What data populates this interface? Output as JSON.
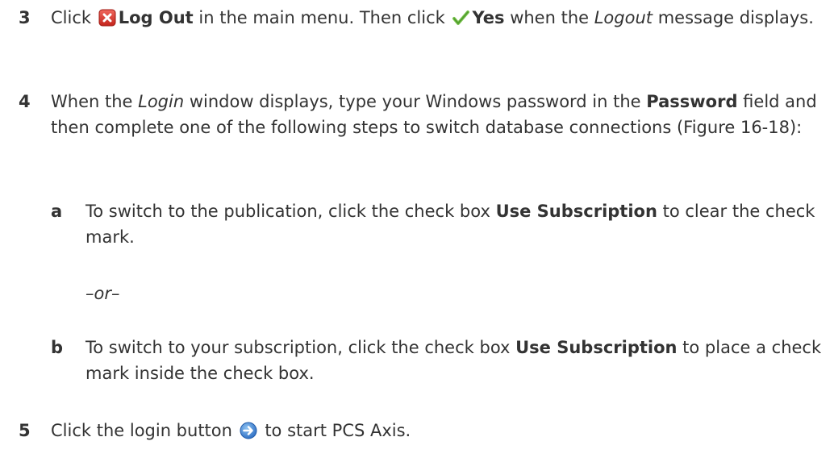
{
  "steps": [
    {
      "number": "3",
      "text_before_icon": "Click ",
      "icon": "logout-x-icon",
      "bold1": "Log Out",
      "text_mid": " in the main menu. Then click ",
      "icon2": "checkmark-icon",
      "bold2": "Yes",
      "text_mid2": " when the ",
      "italic1": "Logout",
      "text_end": " message displays."
    },
    {
      "number": "4",
      "text1": "When the ",
      "italic1": "Login",
      "text2": " window displays, type your Windows password in the ",
      "bold1": "Password",
      "text3": " field and then complete one of the following steps to switch database connections (Figure 16-18):",
      "sub_steps": [
        {
          "letter": "a",
          "text1": "To switch to the publication, click the check box ",
          "bold1": "Use Subscription",
          "text2": " to clear the check mark."
        },
        {
          "letter": "b",
          "text1": "To switch to your subscription, click the check box ",
          "bold1": "Use Subscription",
          "text2": " to place a check mark inside the check box."
        }
      ],
      "or_text": "–or–"
    },
    {
      "number": "5",
      "text1": "Click the login button ",
      "icon": "login-arrow-icon",
      "text2": " to start PCS Axis."
    }
  ],
  "colors": {
    "text": "#333333",
    "logout_icon": "#d9342b",
    "checkmark_icon": "#5cae3a",
    "login_icon": "#3b7fd0"
  }
}
